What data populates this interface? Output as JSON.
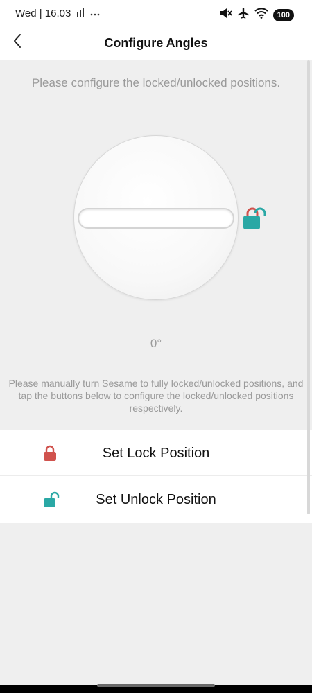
{
  "status_bar": {
    "time": "Wed | 16.03",
    "battery": "100",
    "icons": [
      "signal-bars-icon",
      "more-dots-icon",
      "mute-icon",
      "airplane-icon",
      "wifi-icon",
      "battery-icon"
    ]
  },
  "header": {
    "title": "Configure Angles",
    "back_icon": "chevron-left-icon"
  },
  "intro_text": "Please configure the locked/unlocked positions.",
  "dial": {
    "angle": "0°",
    "state_icon": "unlock-icon"
  },
  "instructions": "Please manually turn Sesame to fully locked/unlocked positions, and tap the buttons below to configure the locked/unlocked positions respectively.",
  "actions": [
    {
      "label": "Set Lock Position",
      "icon": "lock-icon",
      "color": "#d0524d"
    },
    {
      "label": "Set Unlock Position",
      "icon": "unlock-icon",
      "color": "#2aa8a5"
    }
  ],
  "colors": {
    "lock": "#d0524d",
    "unlock": "#2aa8a5",
    "muted_text": "#9a9a9a",
    "background": "#efefef"
  }
}
